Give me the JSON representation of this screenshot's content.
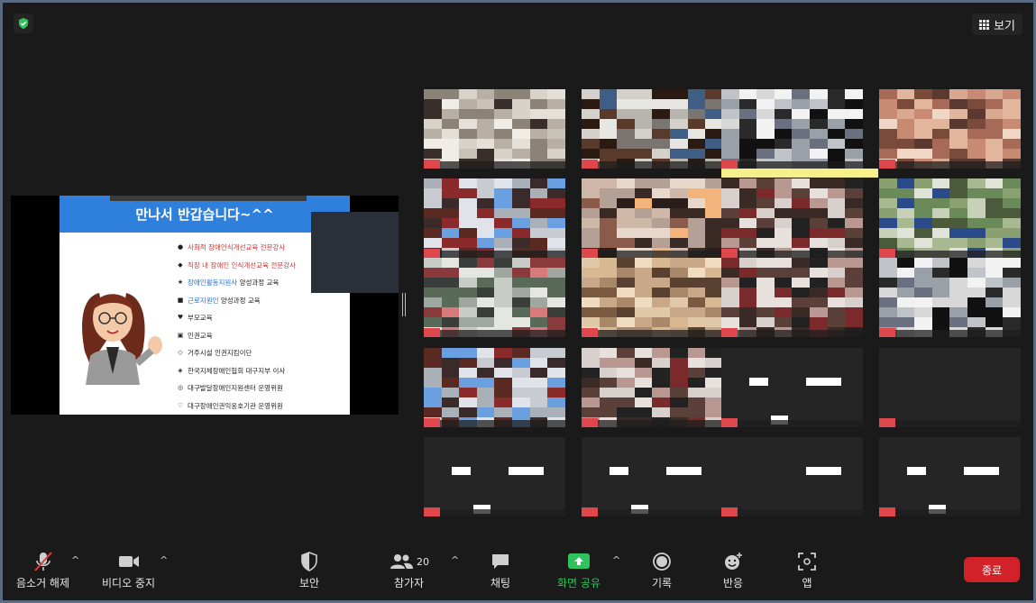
{
  "topbar": {
    "view_label": "보기"
  },
  "slide": {
    "title": "만나서 반갑습니다~^^",
    "bullets": [
      {
        "marker": "●",
        "text": "사회적 장애인식개선교육 전문강사",
        "tone": "red"
      },
      {
        "marker": "◆",
        "text": "직장 내 장애인 인식개선교육 전문강사",
        "tone": "red"
      },
      {
        "marker": "★",
        "text": "장애인활동지원사",
        "suffix": " 양성과정 교육",
        "tone": "blue"
      },
      {
        "marker": "■",
        "text": "근로지원인",
        "suffix": " 양성과정 교육",
        "tone": "blue"
      },
      {
        "marker": "♥",
        "text": "부모교육",
        "tone": "dark"
      },
      {
        "marker": "▣",
        "text": "인권교육",
        "tone": "dark"
      },
      {
        "marker": "◇",
        "text": "거주시설 인권지킴이단",
        "tone": "dark"
      },
      {
        "marker": "◈",
        "text": "한국지체장애인협회 대구지부 이사",
        "tone": "dark"
      },
      {
        "marker": "◎",
        "text": "대구발달장애인지원센터 운영위원",
        "tone": "dark"
      },
      {
        "marker": "♡",
        "text": "대구장애인권익옹호기관 운영위원",
        "tone": "dark"
      }
    ]
  },
  "toolbar": {
    "unmute_label": "음소거 해제",
    "video_label": "비디오 중지",
    "security_label": "보안",
    "participants_label": "참가자",
    "participants_count": "20",
    "chat_label": "채팅",
    "share_label": "화면 공유",
    "record_label": "기록",
    "reactions_label": "반응",
    "apps_label": "앱",
    "end_label": "종료"
  },
  "colors": {
    "end": "#d1222a",
    "share": "#2ec35c",
    "shield": "#2ec35c",
    "slide_header": "#2f7fdc",
    "active_speaker": "#f5f08a"
  }
}
